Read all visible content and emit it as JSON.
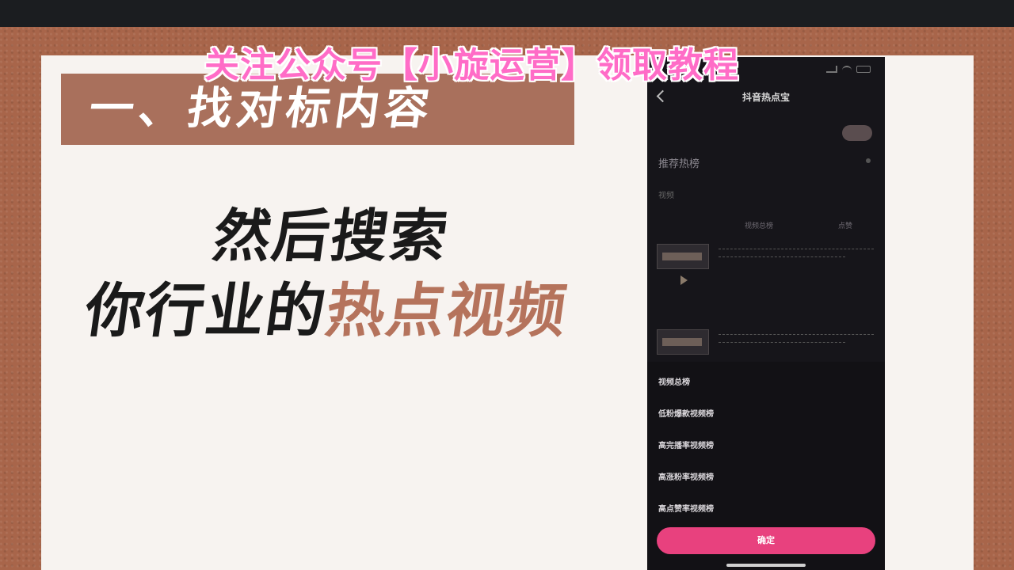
{
  "watermark": "关注公众号【小旋运营】领取教程",
  "section": {
    "title": "一、找对标内容"
  },
  "headline": {
    "line1": "然后搜索",
    "line2_prefix": "你行业的",
    "line2_highlight": "热点视频"
  },
  "phone": {
    "nav_title": "抖音热点宝",
    "recommend_label": "推荐热榜",
    "filter_tab": "视频",
    "filters": [
      "",
      "视频总榜",
      "点赞"
    ],
    "sheet_items": [
      "视频总榜",
      "低粉爆款视频榜",
      "高完播率视频榜",
      "高涨粉率视频榜",
      "高点赞率视频榜"
    ],
    "confirm_label": "确定",
    "accent_color": "#e8417e"
  },
  "colors": {
    "frame": "#a8654a",
    "banner": "#a9705c",
    "highlight": "#b5735c",
    "watermark": "#ff6cc7"
  }
}
